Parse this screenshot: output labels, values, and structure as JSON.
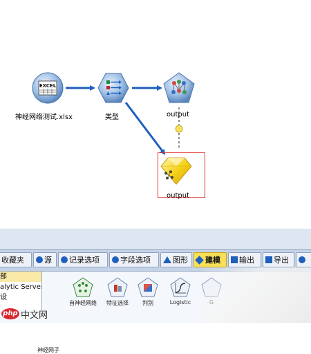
{
  "stream": {
    "nodes": [
      {
        "label": "神经网络测试.xlsx",
        "icon": "excel-icon"
      },
      {
        "label": "类型",
        "icon": "type-icon"
      },
      {
        "label": "output",
        "icon": "neural-net-model-icon"
      },
      {
        "label": "output",
        "icon": "model-nugget-icon"
      }
    ],
    "excel_text": "EXCEL"
  },
  "palette": {
    "tabs": [
      {
        "label": "收藏夹",
        "icon": "none"
      },
      {
        "label": "源",
        "icon": "circle"
      },
      {
        "label": "记录选项",
        "icon": "circle"
      },
      {
        "label": "字段选项",
        "icon": "circle"
      },
      {
        "label": "图形",
        "icon": "triangle"
      },
      {
        "label": "建模",
        "icon": "diamond"
      },
      {
        "label": "输出",
        "icon": "square"
      },
      {
        "label": "导出",
        "icon": "square"
      },
      {
        "label": "",
        "icon": "circle"
      }
    ],
    "active_tab": "建模",
    "list": [
      {
        "label": "部"
      },
      {
        "label": "alytic Server"
      },
      {
        "label": "设"
      }
    ],
    "items": [
      {
        "label": "神经网子"
      },
      {
        "label": "自神经网络"
      },
      {
        "label": "特征选择"
      },
      {
        "label": "判别"
      },
      {
        "label": "Logistic"
      },
      {
        "label": "G"
      }
    ]
  },
  "watermark": {
    "logo_text": "php",
    "site_text": "中文网"
  },
  "colors": {
    "accent": "#1f5fbd",
    "active_tab": "#f7df58",
    "selection": "#e03030"
  }
}
